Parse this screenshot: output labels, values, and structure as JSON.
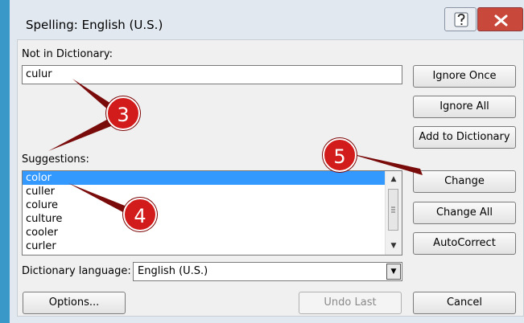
{
  "window": {
    "title": "Spelling: English (U.S.)",
    "help_icon": "help-question-icon",
    "close_icon": "close-x-icon",
    "close_color": "#c9483c"
  },
  "not_in_dictionary": {
    "label": "Not in Dictionary:",
    "value": "culur"
  },
  "suggestions": {
    "label": "Suggestions:",
    "items": [
      "color",
      "culler",
      "colure",
      "culture",
      "cooler",
      "curler"
    ],
    "selected": "color"
  },
  "dictionary_language": {
    "label": "Dictionary language:",
    "value": "English (U.S.)"
  },
  "buttons": {
    "ignore_once": "Ignore Once",
    "ignore_all": "Ignore All",
    "add_to_dictionary": "Add to Dictionary",
    "change": "Change",
    "change_all": "Change All",
    "autocorrect": "AutoCorrect",
    "options": "Options...",
    "undo_last": "Undo Last",
    "cancel": "Cancel"
  },
  "callouts": [
    {
      "number": "3",
      "color": "#d21b1b"
    },
    {
      "number": "4",
      "color": "#d21b1b"
    },
    {
      "number": "5",
      "color": "#d21b1b"
    }
  ]
}
